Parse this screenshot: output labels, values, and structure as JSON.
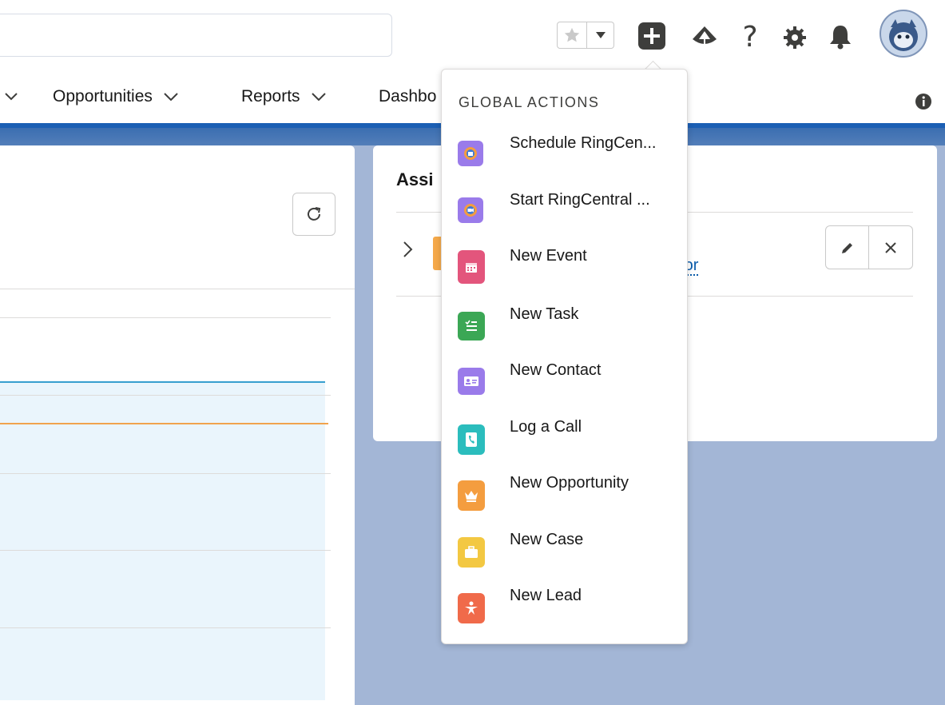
{
  "header": {
    "search_placeholder": ""
  },
  "nav": {
    "items": [
      {
        "label": "Opportunities"
      },
      {
        "label": "Reports"
      },
      {
        "label": "Dashbo"
      }
    ]
  },
  "card": {
    "title": "Assi",
    "link": "ator"
  },
  "global_actions": {
    "heading": "GLOBAL ACTIONS",
    "items": [
      {
        "label": "Schedule RingCen...",
        "icon": "ringcentral-schedule-icon",
        "color": "#9a7bea"
      },
      {
        "label": "Start RingCentral ...",
        "icon": "ringcentral-video-icon",
        "color": "#9a7bea"
      },
      {
        "label": "New Event",
        "icon": "calendar-icon",
        "color": "#e3557c"
      },
      {
        "label": "New Task",
        "icon": "task-icon",
        "color": "#3ba755"
      },
      {
        "label": "New Contact",
        "icon": "contact-icon",
        "color": "#9a7bea"
      },
      {
        "label": "Log a Call",
        "icon": "phone-icon",
        "color": "#2bbdbd"
      },
      {
        "label": "New Opportunity",
        "icon": "crown-icon",
        "color": "#f49d3f"
      },
      {
        "label": "New Case",
        "icon": "briefcase-icon",
        "color": "#f3c842"
      },
      {
        "label": "New Lead",
        "icon": "lead-icon",
        "color": "#f06a4a"
      }
    ]
  }
}
